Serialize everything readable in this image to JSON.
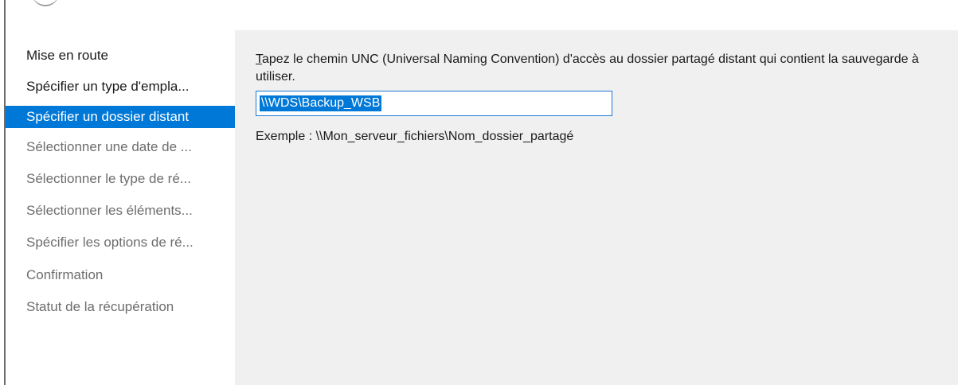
{
  "nav": {
    "items": [
      {
        "label": "Mise en route",
        "state": "done"
      },
      {
        "label": "Spécifier un type d'empla...",
        "state": "done"
      },
      {
        "label": "Spécifier un dossier distant",
        "state": "active"
      },
      {
        "label": "Sélectionner une date de ...",
        "state": "todo"
      },
      {
        "label": "Sélectionner le type de ré...",
        "state": "todo"
      },
      {
        "label": "Sélectionner les éléments...",
        "state": "todo"
      },
      {
        "label": "Spécifier les options de ré...",
        "state": "todo"
      },
      {
        "label": "Confirmation",
        "state": "todo"
      },
      {
        "label": "Statut de la récupération",
        "state": "todo"
      }
    ]
  },
  "content": {
    "prompt_access_key": "T",
    "prompt_rest": "apez le chemin UNC (Universal Naming Convention) d'accès au dossier partagé distant qui contient la sauvegarde à utiliser.",
    "path_value": "\\\\WDS\\Backup_WSB",
    "example": "Exemple : \\\\Mon_serveur_fichiers\\Nom_dossier_partagé"
  },
  "colors": {
    "selection": "#0078d7",
    "content_background": "#f0f0f0",
    "inactive_text": "#6d6d6d"
  }
}
